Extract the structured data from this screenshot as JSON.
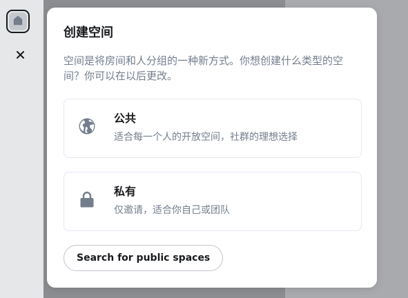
{
  "dialog": {
    "title": "创建空间",
    "description": "空间是将房间和人分组的一种新方式。你想创建什么类型的空间？你可以在以后更改。",
    "options": [
      {
        "title": "公共",
        "subtitle": "适合每一个人的开放空间，社群的理想选择",
        "icon": "globe-icon"
      },
      {
        "title": "私有",
        "subtitle": "仅邀请，适合你自己或团队",
        "icon": "lock-icon"
      }
    ],
    "search_button": "Search for public spaces"
  },
  "left_strip": {
    "home_icon": "home-icon",
    "close_icon": "close-icon"
  },
  "colors": {
    "title": "#17191c",
    "secondary_text": "#737d8c",
    "icon": "#737d8c",
    "border": "#e3e8f0",
    "overlay": "#8f9093"
  }
}
